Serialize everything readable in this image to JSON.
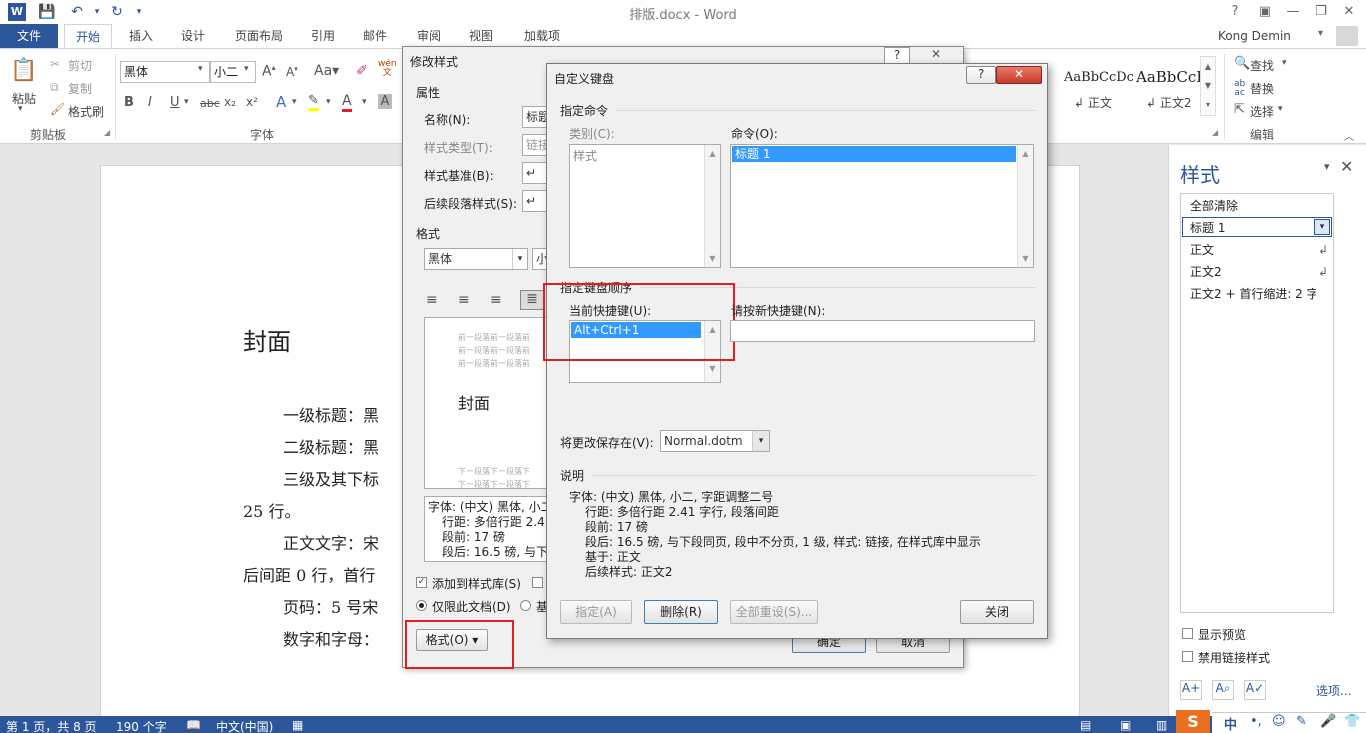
{
  "window": {
    "title": "排版.docx - Word",
    "help": "?",
    "minimize": "—",
    "restore": "❐",
    "close": "✕"
  },
  "tabs": [
    "文件",
    "开始",
    "插入",
    "设计",
    "页面布局",
    "引用",
    "邮件",
    "审阅",
    "视图",
    "加载项"
  ],
  "user": "Kong Demin",
  "ribbon": {
    "paste": "粘贴",
    "cut": "剪切",
    "copy": "复制",
    "format_painter": "格式刷",
    "clipboard_group": "剪贴板",
    "font_name": "黑体",
    "font_size": "小二",
    "font_group": "字体",
    "style_preview_1": "AaBbCcDc",
    "style_preview_2": "AaBbCcI",
    "style_name_1": "↲ 正文",
    "style_name_2": "↲ 正文2",
    "find": "查找",
    "replace": "替换",
    "select": "选择",
    "editing_group": "编辑"
  },
  "document": {
    "heading": "封面",
    "lines": [
      "一级标题：黑",
      "二级标题：黑",
      "三级及其下标",
      "25 行。",
      "正文文字：宋",
      "后间距 0 行，首行",
      "页码：5 号宋",
      "数字和字母："
    ]
  },
  "styles_pane": {
    "title": "样式",
    "clear_all": "全部清除",
    "selected": "标题 1",
    "items": [
      "正文",
      "正文2",
      "正文2 + 首行缩进:  2 字"
    ],
    "show_preview": "显示预览",
    "disable_linked": "禁用链接样式",
    "options": "选项..."
  },
  "modify_dialog": {
    "title": "修改样式",
    "properties_label": "属性",
    "name_label": "名称(N):",
    "name_value": "标题",
    "type_label": "样式类型(T):",
    "type_value": "链接",
    "based_label": "样式基准(B):",
    "based_value": "↵",
    "next_label": "后续段落样式(S):",
    "next_value": "↵",
    "format_label": "格式",
    "font_value": "黑体",
    "size_value": "小",
    "preview_prev": "前一段落前一段落前",
    "preview_text": "封面",
    "preview_next": "下一段落下一段落下",
    "desc_lines": [
      "字体: (中文) 黑体, 小二",
      "行距: 多倍行距 2.41",
      "段前: 17 磅",
      "段后: 16.5 磅, 与下"
    ],
    "add_gallery": "添加到样式库(S)",
    "only_doc": "仅限此文档(D)",
    "based_template": "基",
    "format_btn": "格式(O) ▾",
    "ok": "确定",
    "cancel": "取消"
  },
  "keyboard_dialog": {
    "title": "自定义键盘",
    "specify_command": "指定命令",
    "categories_label": "类别(C):",
    "categories_item": "样式",
    "commands_label": "命令(O):",
    "commands_item": "标题 1",
    "specify_key": "指定键盘顺序",
    "current_keys_label": "当前快捷键(U):",
    "current_key": "Alt+Ctrl+1",
    "new_key_label": "请按新快捷键(N):",
    "save_in_label": "将更改保存在(V):",
    "save_in_value": "Normal.dotm",
    "description_label": "说明",
    "description": [
      "字体: (中文) 黑体, 小二, 字距调整二号",
      "行距: 多倍行距 2.41 字行, 段落间距",
      "段前: 17 磅",
      "段后: 16.5 磅, 与下段同页, 段中不分页, 1 级, 样式: 链接, 在样式库中显示",
      "基于: 正文",
      "后续样式: 正文2"
    ],
    "assign": "指定(A)",
    "remove": "删除(R)",
    "reset_all": "全部重设(S)...",
    "close": "关闭"
  },
  "status": {
    "page": "第 1 页，共 8 页",
    "words": "190 个字",
    "lang": "中文(中国)"
  }
}
